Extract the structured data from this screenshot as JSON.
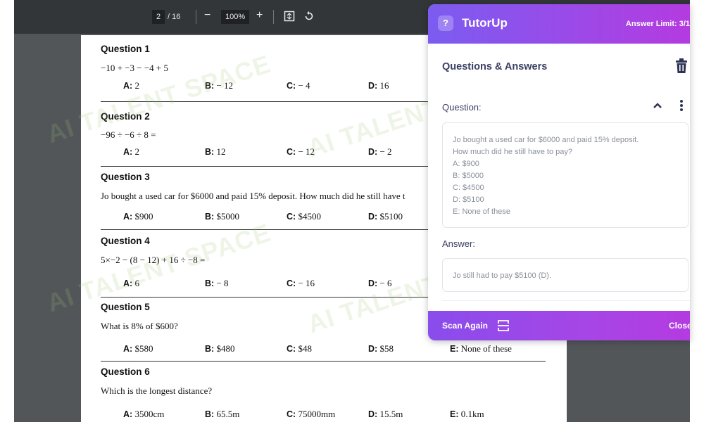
{
  "toolbar": {
    "page_current": "2",
    "page_total": "/ 16",
    "zoom_out": "−",
    "zoom": "100%",
    "zoom_in": "+"
  },
  "document": {
    "questions": [
      {
        "title": "Question 1",
        "text": "−10 + −3 − −4 + 5",
        "options": [
          {
            "label": "A:",
            "value": "2"
          },
          {
            "label": "B:",
            "value": "− 12"
          },
          {
            "label": "C:",
            "value": "− 4"
          },
          {
            "label": "D:",
            "value": "16"
          }
        ]
      },
      {
        "title": "Question 2",
        "text": "−96 ÷ −6 ÷ 8 =",
        "options": [
          {
            "label": "A:",
            "value": "2"
          },
          {
            "label": "B:",
            "value": "12"
          },
          {
            "label": "C:",
            "value": "− 12"
          },
          {
            "label": "D:",
            "value": "− 2"
          }
        ]
      },
      {
        "title": "Question 3",
        "text": "Jo bought a used car for $6000 and paid 15% deposit. How much did he still have t",
        "options": [
          {
            "label": "A:",
            "value": "$900"
          },
          {
            "label": "B:",
            "value": "$5000"
          },
          {
            "label": "C:",
            "value": "$4500"
          },
          {
            "label": "D:",
            "value": "$5100"
          }
        ]
      },
      {
        "title": "Question 4",
        "text": "5×−2 − (8 − 12) + 16 ÷ −8 =",
        "options": [
          {
            "label": "A:",
            "value": "6"
          },
          {
            "label": "B:",
            "value": "− 8"
          },
          {
            "label": "C:",
            "value": "− 16"
          },
          {
            "label": "D:",
            "value": "− 6"
          }
        ]
      },
      {
        "title": "Question 5",
        "text": "What is 8% of $600?",
        "options": [
          {
            "label": "A:",
            "value": "$580"
          },
          {
            "label": "B:",
            "value": "$480"
          },
          {
            "label": "C:",
            "value": "$48"
          },
          {
            "label": "D:",
            "value": "$58"
          },
          {
            "label": "E:",
            "value": "None of these"
          }
        ]
      },
      {
        "title": "Question 6",
        "text": "Which is the longest distance?",
        "options": [
          {
            "label": "A:",
            "value": "3500cm"
          },
          {
            "label": "B:",
            "value": "65.5m"
          },
          {
            "label": "C:",
            "value": "75000mm"
          },
          {
            "label": "D:",
            "value": "15.5m"
          },
          {
            "label": "E:",
            "value": "0.1km"
          }
        ]
      }
    ]
  },
  "watermark": {
    "text": "AI TALENT SPACE"
  },
  "panel": {
    "brand": "TutorUp",
    "answer_limit": "Answer Limit: 3/1",
    "title": "Questions & Answers",
    "question_label": "Question:",
    "question_lines": [
      "Jo bought a used car for $6000 and paid 15% deposit.",
      "How much did he still have to pay?",
      "A: $900",
      "B: $5000",
      "C: $4500",
      "D: $5100",
      "E: None of these"
    ],
    "answer_label": "Answer:",
    "answer_text": "Jo still had to pay $5100 (D).",
    "scan_again": "Scan Again",
    "close": "Close"
  },
  "colors": {
    "panel_gradient_start": "#7b5cf0",
    "panel_gradient_end": "#b43be0",
    "toolbar_bg": "#323639",
    "viewer_bg": "#525659"
  }
}
